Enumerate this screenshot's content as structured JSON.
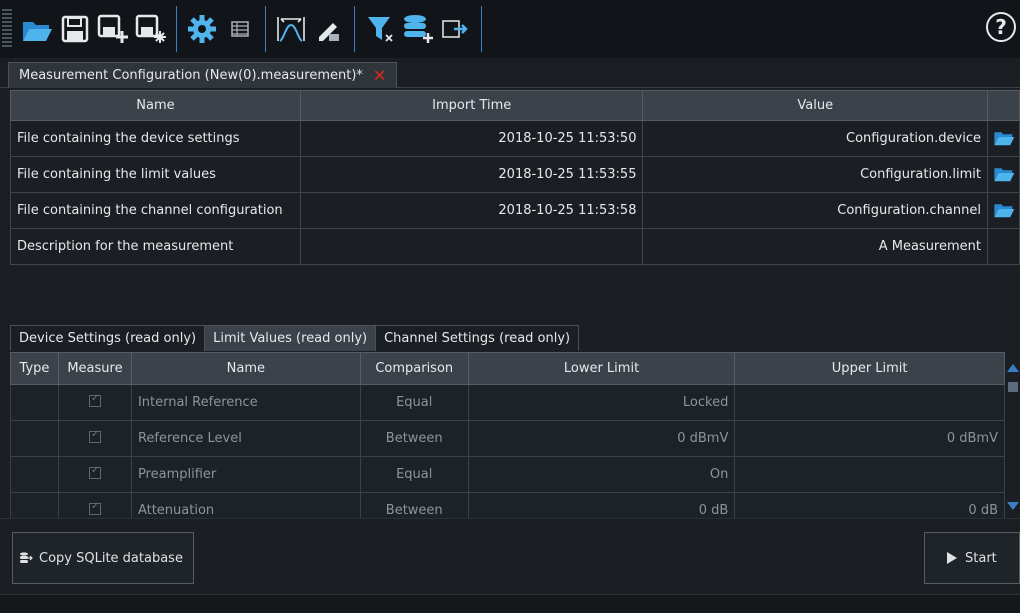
{
  "toolbar": {
    "buttons": [
      "open-folder-icon",
      "save-icon",
      "save-add-icon",
      "save-all-icon",
      "gear-icon",
      "table-icon",
      "spectrum-icon",
      "measure-edit-icon",
      "filter-clear-icon",
      "database-add-icon",
      "export-csv-icon"
    ],
    "help": "?",
    "accent": "#3a7fc4"
  },
  "doc_tab": {
    "title": "Measurement Configuration (New(0).measurement)*",
    "close": "✕"
  },
  "config": {
    "headers": {
      "name": "Name",
      "import_time": "Import Time",
      "value": "Value"
    },
    "rows": [
      {
        "name": "File containing the device settings",
        "time": "2018-10-25 11:53:50",
        "value": "Configuration.device"
      },
      {
        "name": "File containing the limit values",
        "time": "2018-10-25 11:53:55",
        "value": "Configuration.limit"
      },
      {
        "name": "File containing the channel configuration",
        "time": "2018-10-25 11:53:58",
        "value": "Configuration.channel"
      },
      {
        "name": "Description for the measurement",
        "time": "",
        "value": "A Measurement"
      }
    ]
  },
  "subtabs": [
    "Device Settings (read only)",
    "Limit Values (read only)",
    "Channel Settings (read only)"
  ],
  "grid": {
    "headers": {
      "type": "Type",
      "measure": "Measure",
      "name": "Name",
      "comparison": "Comparison",
      "lower": "Lower Limit",
      "upper": "Upper Limit"
    },
    "rows": [
      {
        "name": "Internal Reference",
        "comparison": "Equal",
        "lower": "Locked",
        "upper": ""
      },
      {
        "name": "Reference Level",
        "comparison": "Between",
        "lower": "0 dBmV",
        "upper": "0 dBmV"
      },
      {
        "name": "Preamplifier",
        "comparison": "Equal",
        "lower": "On",
        "upper": ""
      },
      {
        "name": "Attenuation",
        "comparison": "Between",
        "lower": "0 dB",
        "upper": "0 dB"
      }
    ]
  },
  "buttons": {
    "copy": "Copy SQLite database",
    "start": "Start"
  }
}
